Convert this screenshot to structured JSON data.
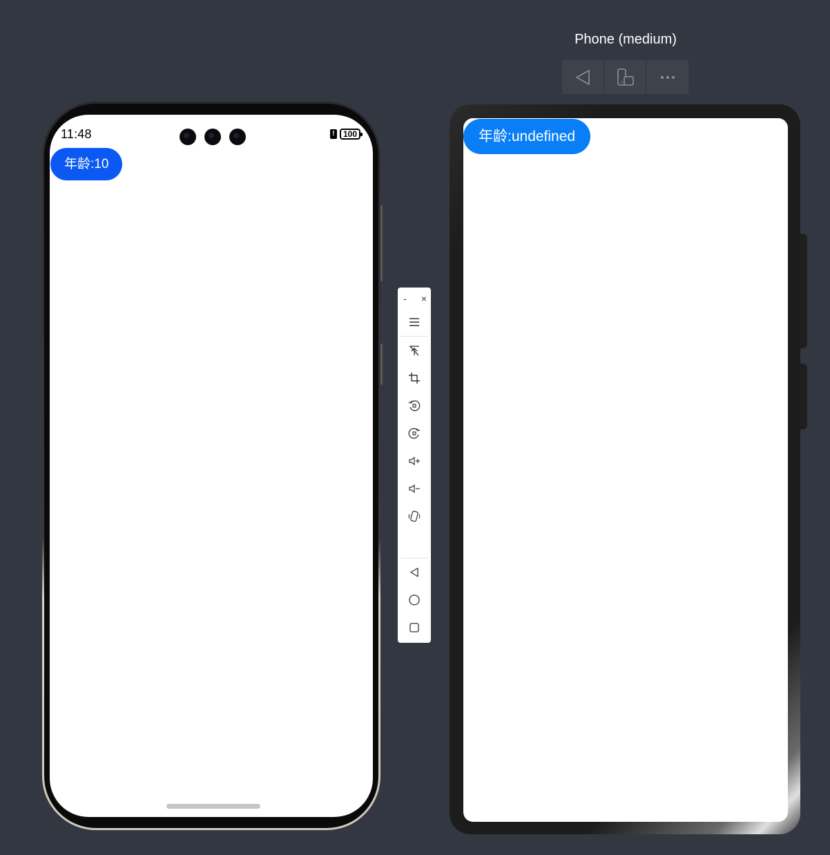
{
  "left_device": {
    "status_bar": {
      "time": "11:48",
      "sim_label": "!",
      "battery_level": "100"
    },
    "age_button_label": "年龄:10"
  },
  "toolbar": {
    "minimize_label": "-",
    "close_label": "×",
    "items": [
      "menu-icon",
      "pin-top-icon",
      "crop-icon",
      "rotate-left-icon",
      "rotate-right-icon",
      "volume-up-icon",
      "volume-down-icon",
      "shake-icon",
      "back-icon",
      "home-icon",
      "recents-icon"
    ]
  },
  "preview": {
    "title": "Phone (medium)",
    "age_button_label": "年龄:undefined"
  }
}
